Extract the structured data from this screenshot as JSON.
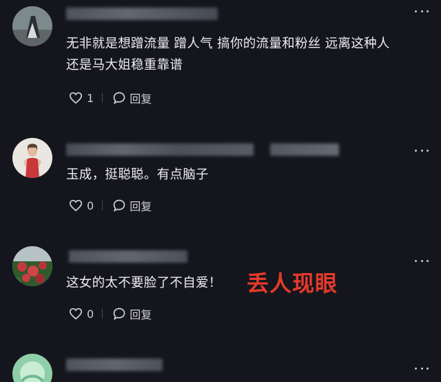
{
  "comments": [
    {
      "text_line1": "无非就是想蹭流量 蹭人气 搞你的流量和粉丝 远离这种人",
      "text_line2": "还是马大姐稳重靠谱",
      "like_count": "1",
      "reply_label": "回复"
    },
    {
      "text_line1": "玉成，挺聪聪。有点脑子",
      "like_count": "0",
      "reply_label": "回复"
    },
    {
      "text_line1": "这女的太不要脸了不自爱！",
      "like_count": "0",
      "reply_label": "回复"
    },
    {
      "text_line1": ""
    }
  ],
  "overlay_caption": "丢人现眼",
  "colors": {
    "background": "#15161d",
    "text": "#ececf1",
    "overlay_red": "#e53a2a"
  }
}
